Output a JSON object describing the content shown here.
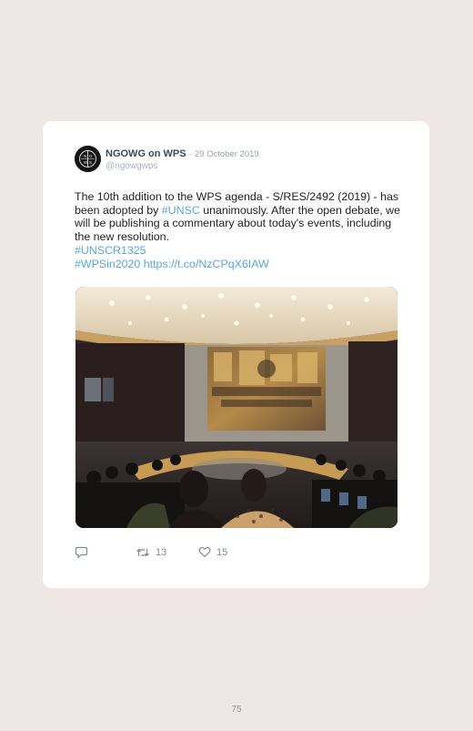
{
  "tweet": {
    "author_name": "NGOWG on WPS",
    "separator": "·",
    "date": "29 October 2019",
    "handle": "@ngowgwps",
    "text_1": "The 10th addition to the WPS agenda - S/RES/2492 (2019) - has been adopted by ",
    "link_unsc": "#UNSC",
    "text_2": " unanimously. After the open debate, we will be publishing a commentary about today's events, including the new resolution.",
    "link_unscr": "#UNSCR1325",
    "link_wps": "#WPSin2020",
    "link_url": "https://t.co/NzCPqX6IAW",
    "avatar_logo_text": "NGOWG WPS",
    "photo_subject": "UN Security Council chamber"
  },
  "actions": {
    "reply_icon": "reply-icon",
    "retweet_icon": "retweet-icon",
    "retweet_count": "13",
    "like_icon": "heart-icon",
    "like_count": "15"
  },
  "colors": {
    "page_background": "#efe6e6",
    "card_background": "#ffffff",
    "link": "#5aa7dd"
  },
  "page": {
    "number": "75"
  }
}
